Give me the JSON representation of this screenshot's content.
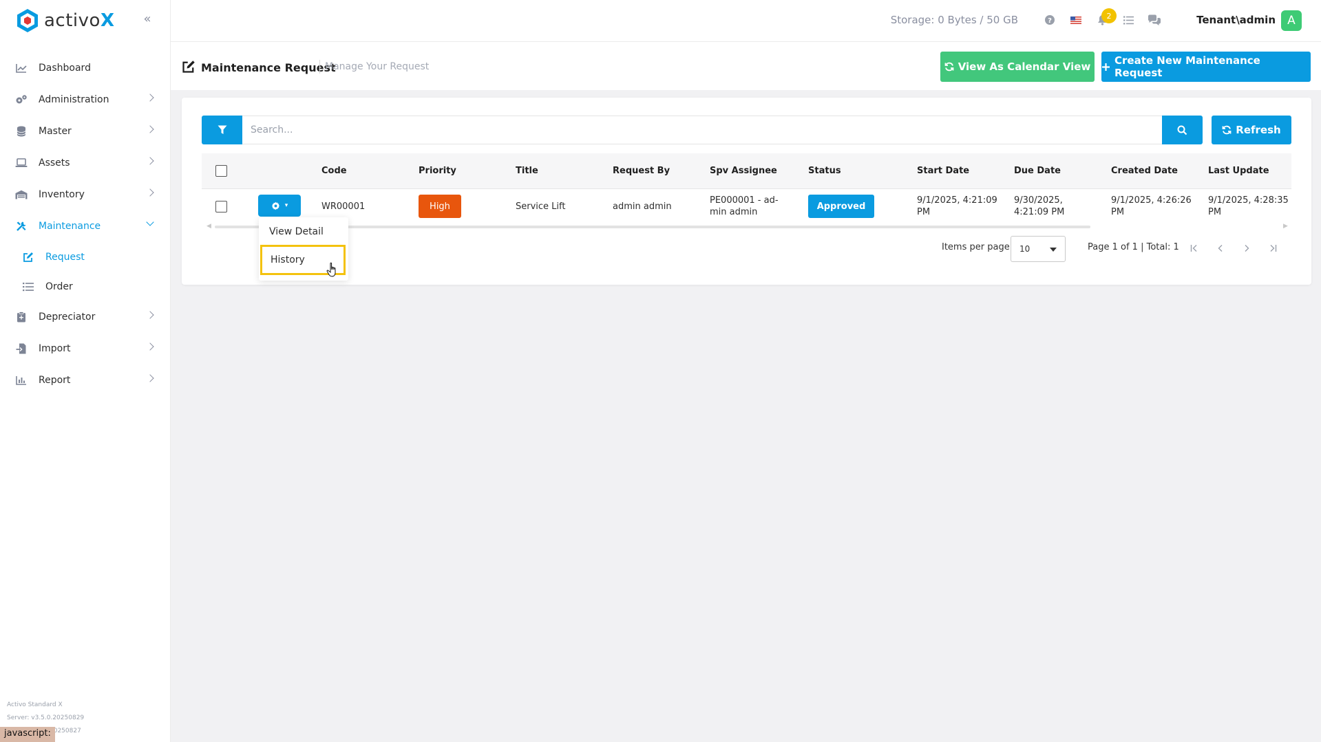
{
  "app": {
    "logo_prefix": "activo",
    "logo_suffix": "X"
  },
  "topbar": {
    "storage": "Storage: 0 Bytes / 50 GB",
    "notification_count": "2",
    "user": "Tenant\\admin",
    "avatar_letter": "A"
  },
  "sidebar": {
    "items": [
      {
        "label": "Dashboard",
        "icon": "chart-line-icon"
      },
      {
        "label": "Administration",
        "icon": "cogs-icon"
      },
      {
        "label": "Master",
        "icon": "database-icon"
      },
      {
        "label": "Assets",
        "icon": "laptop-icon"
      },
      {
        "label": "Inventory",
        "icon": "warehouse-icon"
      },
      {
        "label": "Maintenance",
        "icon": "tools-icon"
      },
      {
        "label": "Depreciator",
        "icon": "clipboard-icon"
      },
      {
        "label": "Import",
        "icon": "file-import-icon"
      },
      {
        "label": "Report",
        "icon": "chart-bar-icon"
      }
    ],
    "subitems": [
      {
        "label": "Request",
        "icon": "edit-icon"
      },
      {
        "label": "Order",
        "icon": "list-icon"
      }
    ],
    "footer_line1": "Activo Standard X",
    "footer_line2": "Server: v3.5.0.20250829",
    "footer_line3": "20250827",
    "status_text": "javascript:"
  },
  "page": {
    "title": "Maintenance Request",
    "subtitle": "Manage Your Request",
    "calendar_button": "View As Calendar View",
    "create_button": "Create New Maintenance Request"
  },
  "search": {
    "placeholder": "Search...",
    "refresh_label": "Refresh"
  },
  "table": {
    "headers": [
      "Code",
      "Priority",
      "Title",
      "Request By",
      "Spv Assignee",
      "Status",
      "Start Date",
      "Due Date",
      "Created Date",
      "Last Update"
    ],
    "rows": [
      {
        "code": "WR00001",
        "priority": "High",
        "title": "Service Lift",
        "request_by": "admin admin",
        "spv_assignee_1": "PE000001 - ad-",
        "spv_assignee_2": "min admin",
        "status": "Approved",
        "start_date_1": "9/1/2025, 4:21:09",
        "start_date_2": "PM",
        "due_date_1": "9/30/2025,",
        "due_date_2": "4:21:09 PM",
        "created_date_1": "9/1/2025, 4:26:26",
        "created_date_2": "PM",
        "last_update_1": "9/1/2025, 4:28:35",
        "last_update_2": "PM"
      }
    ]
  },
  "pager": {
    "items_per_page_label": "Items per page",
    "items_per_page_value": "10",
    "page_info": "Page 1 of 1 | Total: 1"
  },
  "dropdown": {
    "items": [
      "View Detail",
      "History"
    ]
  },
  "colors": {
    "primary": "#0a9be0",
    "success": "#42c77c",
    "priority_high": "#e8560d",
    "highlight": "#f4c20d"
  }
}
